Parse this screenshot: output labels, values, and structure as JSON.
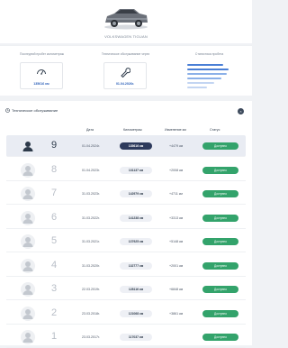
{
  "vehicle": {
    "name": "VOLKSWAGEN TIGUAN"
  },
  "stats": [
    {
      "title": "Последний пробег километраж",
      "value": "135616 км",
      "icon": "gauge-icon"
    },
    {
      "title": "Техническое обслуживание через",
      "value": "01.04.2026г.",
      "icon": "wrench-icon"
    },
    {
      "title": "Статистика пробега",
      "value": "",
      "icon": "bars-chart-icon"
    }
  ],
  "table": {
    "title": "Техническое обслуживание",
    "close_label": "×",
    "headers": {
      "date": "Дата",
      "mileage": "Километраж",
      "delta": "Изменение км",
      "status": "Статус"
    },
    "rows": [
      {
        "num": "9",
        "date": "01.04.2024г.",
        "mileage": "135616 км",
        "delta": "+4479 км",
        "status": "Доступно",
        "active": true
      },
      {
        "num": "8",
        "date": "01.04.2023г.",
        "mileage": "131137 км",
        "delta": "+2008 км",
        "status": "Доступно",
        "active": false
      },
      {
        "num": "7",
        "date": "31.03.2023г.",
        "mileage": "142979 км",
        "delta": "+4711 км",
        "status": "Доступно",
        "active": false
      },
      {
        "num": "6",
        "date": "31.03.2022г.",
        "mileage": "141238 км",
        "delta": "+3313 км",
        "status": "Доступно",
        "active": false
      },
      {
        "num": "5",
        "date": "31.03.2021г.",
        "mileage": "137925 км",
        "delta": "+5148 км",
        "status": "Доступно",
        "active": false
      },
      {
        "num": "4",
        "date": "31.03.2020г.",
        "mileage": "132777 км",
        "delta": "+2001 км",
        "status": "Доступно",
        "active": false
      },
      {
        "num": "3",
        "date": "22.03.2019г.",
        "mileage": "128116 км",
        "delta": "+6848 км",
        "status": "Доступно",
        "active": false
      },
      {
        "num": "2",
        "date": "23.03.2018г.",
        "mileage": "121068 км",
        "delta": "+3861 км",
        "status": "Доступно",
        "active": false
      },
      {
        "num": "1",
        "date": "23.03.2017г.",
        "mileage": "117037 км",
        "delta": "",
        "status": "Доступно",
        "active": false
      }
    ]
  },
  "colors": {
    "accent": "#2b5fb8",
    "status_green": "#33a36b",
    "active_row": "#e9ecf3",
    "chart_blue": "#4a7fd6"
  }
}
